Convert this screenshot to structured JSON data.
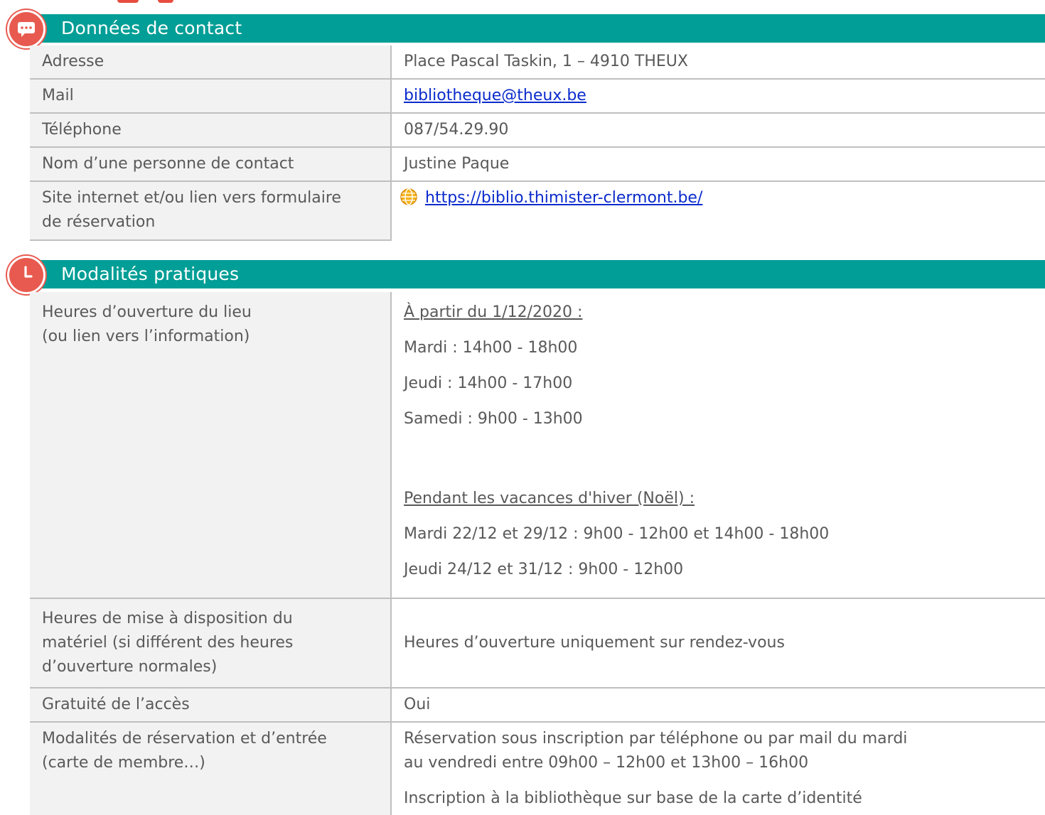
{
  "section_contact": {
    "title": "Données de contact",
    "rows": {
      "address": {
        "label": "Adresse",
        "value": "Place Pascal Taskin, 1 – 4910 THEUX"
      },
      "mail": {
        "label": "Mail",
        "value": "bibliotheque@theux.be"
      },
      "phone": {
        "label": "Téléphone",
        "value": "087/54.29.90"
      },
      "contact_person": {
        "label": "Nom d’une personne de contact",
        "value": "Justine Paque"
      },
      "website": {
        "label_line1": "Site internet et/ou lien vers formulaire",
        "label_line2": "de réservation",
        "value": "https://biblio.thimister-clermont.be/"
      }
    }
  },
  "section_practical": {
    "title": "Modalités pratiques",
    "rows": {
      "opening_hours": {
        "label_line1": "Heures d’ouverture du lieu",
        "label_line2": "(ou lien vers l’information)",
        "heading1": "À partir du 1/12/2020 :",
        "lines1": [
          "Mardi : 14h00 - 18h00",
          "Jeudi : 14h00 - 17h00",
          "Samedi : 9h00 - 13h00"
        ],
        "heading2": "Pendant les vacances d'hiver (Noël) :",
        "lines2": [
          "Mardi 22/12 et 29/12 : 9h00 - 12h00 et 14h00 - 18h00",
          "Jeudi 24/12 et 31/12 : 9h00 - 12h00"
        ]
      },
      "material_hours": {
        "label_line1": "Heures de mise à disposition du",
        "label_line2": "matériel (si différent des heures",
        "label_line3": "d’ouverture normales)",
        "value": "Heures d’ouverture uniquement sur rendez-vous"
      },
      "free_access": {
        "label": "Gratuité de l’accès",
        "value": "Oui"
      },
      "reservation": {
        "label_line1": "Modalités de réservation et d’entrée",
        "label_line2": "(carte de membre…)",
        "value_line1": "Réservation sous inscription par téléphone ou par mail du mardi",
        "value_line2": "au vendredi entre 09h00 – 12h00 et 13h00 – 16h00",
        "value_line3": "Inscription à la bibliothèque sur base de la carte d’identité"
      }
    }
  },
  "colors": {
    "header_bg": "#009e96",
    "badge": "#e85a4f",
    "label_bg": "#f2f2f2",
    "link": "#0a2bcc"
  },
  "icons": {
    "contact_badge": "chat-bubble-icon",
    "practical_badge": "clock-icon",
    "website": "globe-icon"
  }
}
